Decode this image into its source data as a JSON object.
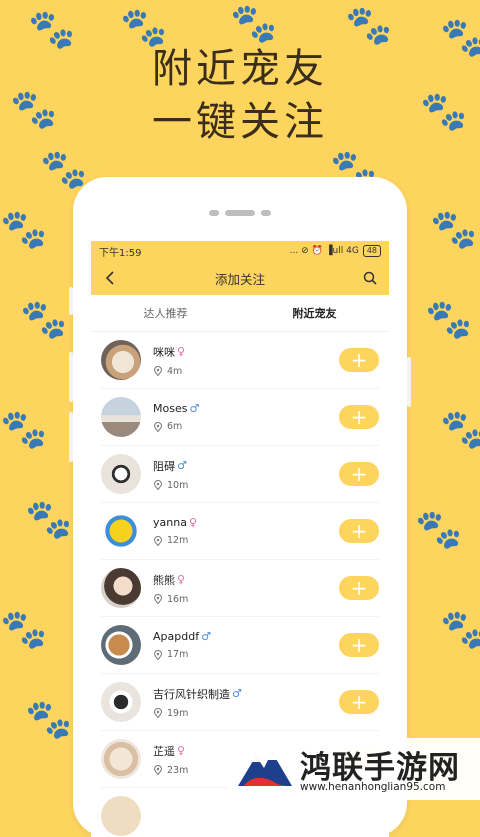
{
  "headline": {
    "line1": "附近宠友",
    "line2": "一键关注"
  },
  "status_bar": {
    "time": "下午1:59",
    "icons": "... ⊘ ⏰ ▐ull 4G",
    "battery": "48"
  },
  "nav": {
    "title": "添加关注",
    "back_icon": "back-arrow-icon",
    "search_icon": "search-icon"
  },
  "tabs": [
    {
      "label": "达人推荐",
      "active": false
    },
    {
      "label": "附近宠友",
      "active": true
    }
  ],
  "list": {
    "items": [
      {
        "name": "咪咪",
        "sex": "♀",
        "distance": "4m"
      },
      {
        "name": "Moses",
        "sex": "♂",
        "distance": "6m"
      },
      {
        "name": "阻碍",
        "sex": "♂",
        "distance": "10m"
      },
      {
        "name": "yanna",
        "sex": "♀",
        "distance": "12m"
      },
      {
        "name": "熊熊",
        "sex": "♀",
        "distance": "16m"
      },
      {
        "name": "Apapddf",
        "sex": "♂",
        "distance": "17m"
      },
      {
        "name": "吉行风针织制造",
        "sex": "♂",
        "distance": "19m"
      },
      {
        "name": "芷遥",
        "sex": "♀",
        "distance": "23m"
      }
    ],
    "add_label": "+"
  },
  "watermark": {
    "title": "鸿联手游网",
    "url": "www.henanhonglian95.com"
  },
  "colors": {
    "background": "#FDD45E",
    "accent": "#FDD45E",
    "female": "#E06FA5",
    "male": "#4D8FD6"
  }
}
